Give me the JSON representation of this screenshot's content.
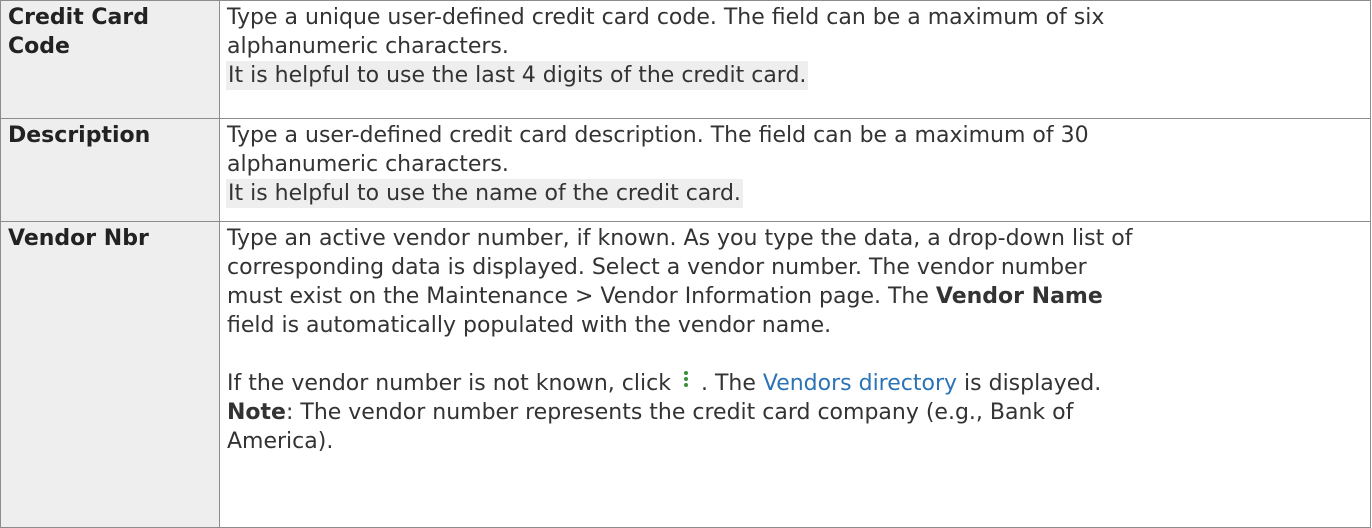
{
  "rows": [
    {
      "label": "Credit Card Code",
      "line1": "Type a unique user-defined credit card code. The field can be a maximum of six",
      "line2": "alphanumeric characters.",
      "tip": "It is helpful to use the last 4 digits of the credit card."
    },
    {
      "label": "Description",
      "line1": "Type a user-defined credit card description. The field can be a maximum of 30",
      "line2": "alphanumeric characters.",
      "tip": "It is helpful to use the name of the credit card."
    },
    {
      "label": "Vendor Nbr",
      "p1_lines": [
        "Type an active vendor number, if known. As you type the data, a drop-down list of",
        "corresponding data is displayed. Select a vendor number. The vendor number",
        "must exist on the Maintenance > Vendor Information page. The "
      ],
      "vendor_name_bold": "Vendor Name",
      "p1_last": "field is automatically populated with the vendor name.",
      "p2_before_icon": "If the vendor number is not known, click",
      "lookup_icon": "vertical-ellipsis-icon",
      "p2_after_icon": ". The",
      "link_text": "Vendors directory",
      "p2_end": "is displayed.",
      "note_label": "Note",
      "note_text_1": ": The vendor number represents the credit card company (e.g., Bank of",
      "note_text_2": "America)."
    }
  ],
  "colors": {
    "link": "#2b73b7",
    "label_bg": "#eeeeee",
    "tip_bg": "#eeeeee",
    "border": "#8c8c8c",
    "icon": "#3a8f3a"
  }
}
